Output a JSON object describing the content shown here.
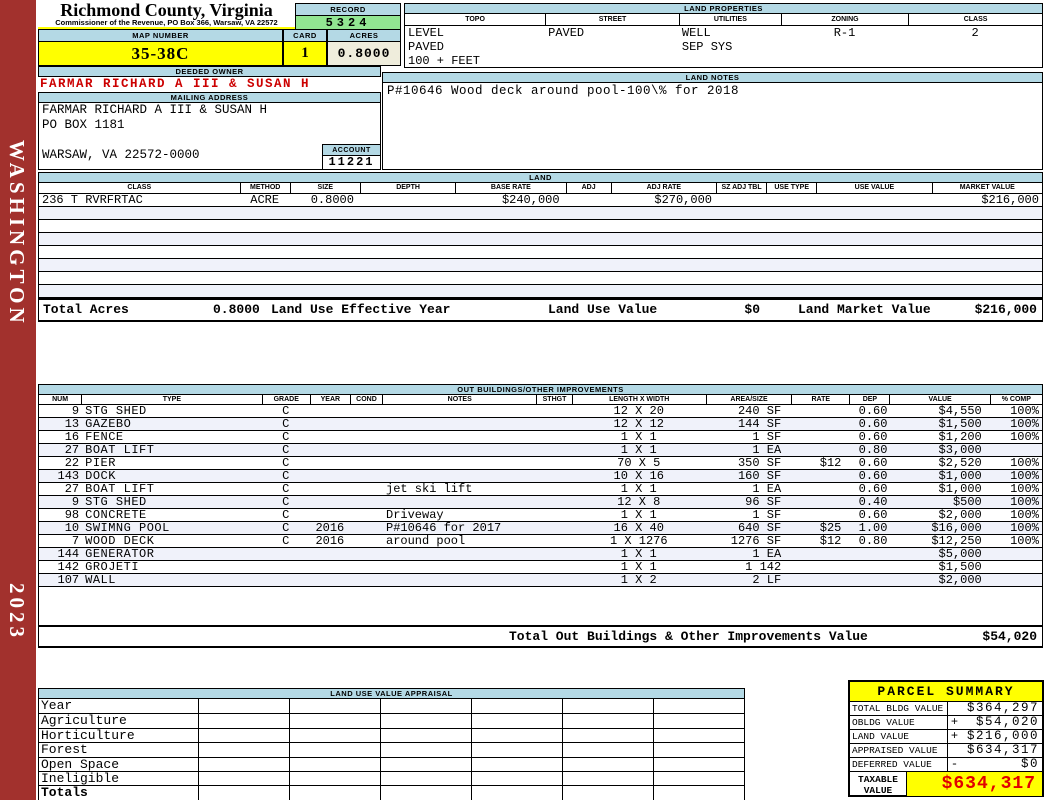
{
  "colors": {
    "sidebar": "#A2312D",
    "bar_blue": "#B4D9E5",
    "value_green": "#92E692",
    "value_yellow": "#FFFF00",
    "value_cream": "#EFEDDC",
    "stripe": "#F0F2FA",
    "owner_red": "#CC0000",
    "taxable_red": "#E10000"
  },
  "sidebar": {
    "county_name": "WASHINGTON",
    "year": "2023"
  },
  "header": {
    "title": "Richmond County, Virginia",
    "subtitle": "Commissioner of the Revenue, PO Box 366, Warsaw, VA 22572",
    "record_label": "RECORD",
    "record_value": "5324",
    "map_number_label": "MAP NUMBER",
    "map_number_value": "35-38C",
    "card_label": "CARD",
    "card_value": "1",
    "acres_label": "ACRES",
    "acres_value": "0.8000",
    "deeded_owner_label": "DEEDED OWNER",
    "deeded_owner": "FARMAR RICHARD A III & SUSAN H",
    "mailing_address_label": "MAILING ADDRESS",
    "mailing_lines": [
      "FARMAR RICHARD A III & SUSAN H",
      "PO BOX 1181",
      "",
      "WARSAW, VA 22572-0000"
    ],
    "account_label": "ACCOUNT",
    "account_value": "11221"
  },
  "land_properties": {
    "title": "LAND PROPERTIES",
    "columns": [
      "TOPO",
      "STREET",
      "UTILITIES",
      "ZONING",
      "CLASS"
    ],
    "rows": [
      {
        "topo": "LEVEL",
        "street": "PAVED",
        "utilities": "WELL",
        "zoning": "R-1",
        "class": "2"
      },
      {
        "topo": "PAVED",
        "street": "",
        "utilities": "SEP SYS",
        "zoning": "",
        "class": ""
      },
      {
        "topo": "100 + FEET",
        "street": "",
        "utilities": "",
        "zoning": "",
        "class": ""
      }
    ]
  },
  "land_notes": {
    "title": "LAND NOTES",
    "text": "P#10646 Wood deck around pool-100\\% for 2018"
  },
  "land": {
    "title": "LAND",
    "columns": [
      "CLASS",
      "METHOD",
      "SIZE",
      "DEPTH",
      "BASE RATE",
      "ADJ",
      "ADJ RATE",
      "SZ ADJ TBL",
      "USE TYPE",
      "USE VALUE",
      "MARKET VALUE"
    ],
    "rows": [
      {
        "class": "236 T RVRFRTAC",
        "method": "ACRE",
        "size": "0.8000",
        "depth": "",
        "base_rate": "$240,000",
        "adj": "",
        "adj_rate": "$270,000",
        "sz_adj_tbl": "",
        "use_type": "",
        "use_value": "",
        "market_value": "$216,000"
      }
    ],
    "totals": {
      "total_acres_label": "Total Acres",
      "total_acres": "0.8000",
      "effective_year_label": "Land Use Effective Year",
      "use_value_label": "Land Use Value",
      "use_value": "$0",
      "market_value_label": "Land Market Value",
      "market_value": "$216,000"
    }
  },
  "out_buildings": {
    "title": "OUT BUILDINGS/OTHER IMPROVEMENTS",
    "columns": [
      "NUM",
      "TYPE",
      "GRADE",
      "YEAR",
      "COND",
      "NOTES",
      "STHGT",
      "LENGTH X WIDTH",
      "AREA/SIZE",
      "RATE",
      "DEP",
      "VALUE",
      "% COMP"
    ],
    "rows": [
      {
        "num": "9",
        "type": "STG SHED",
        "grade": "C",
        "year": "",
        "cond": "",
        "notes": "",
        "sthgt": "",
        "lxw": "12 X 20",
        "area": "240 SF",
        "rate": "",
        "dep": "0.60",
        "value": "$4,550",
        "comp": "100%"
      },
      {
        "num": "13",
        "type": "GAZEBO",
        "grade": "C",
        "year": "",
        "cond": "",
        "notes": "",
        "sthgt": "",
        "lxw": "12 X 12",
        "area": "144 SF",
        "rate": "",
        "dep": "0.60",
        "value": "$1,500",
        "comp": "100%"
      },
      {
        "num": "16",
        "type": "FENCE",
        "grade": "C",
        "year": "",
        "cond": "",
        "notes": "",
        "sthgt": "",
        "lxw": "1 X 1",
        "area": "1 SF",
        "rate": "",
        "dep": "0.60",
        "value": "$1,200",
        "comp": "100%"
      },
      {
        "num": "27",
        "type": "BOAT LIFT",
        "grade": "C",
        "year": "",
        "cond": "",
        "notes": "",
        "sthgt": "",
        "lxw": "1 X 1",
        "area": "1 EA",
        "rate": "",
        "dep": "0.80",
        "value": "$3,000",
        "comp": ""
      },
      {
        "num": "22",
        "type": "PIER",
        "grade": "C",
        "year": "",
        "cond": "",
        "notes": "",
        "sthgt": "",
        "lxw": "70 X 5",
        "area": "350 SF",
        "rate": "$12",
        "dep": "0.60",
        "value": "$2,520",
        "comp": "100%"
      },
      {
        "num": "143",
        "type": "DOCK",
        "grade": "C",
        "year": "",
        "cond": "",
        "notes": "",
        "sthgt": "",
        "lxw": "10 X 16",
        "area": "160 SF",
        "rate": "",
        "dep": "0.60",
        "value": "$1,000",
        "comp": "100%"
      },
      {
        "num": "27",
        "type": "BOAT LIFT",
        "grade": "C",
        "year": "",
        "cond": "",
        "notes": "jet ski lift",
        "sthgt": "",
        "lxw": "1 X 1",
        "area": "1 EA",
        "rate": "",
        "dep": "0.60",
        "value": "$1,000",
        "comp": "100%"
      },
      {
        "num": "9",
        "type": "STG SHED",
        "grade": "C",
        "year": "",
        "cond": "",
        "notes": "",
        "sthgt": "",
        "lxw": "12 X 8",
        "area": "96 SF",
        "rate": "",
        "dep": "0.40",
        "value": "$500",
        "comp": "100%"
      },
      {
        "num": "98",
        "type": "CONCRETE",
        "grade": "C",
        "year": "",
        "cond": "",
        "notes": "Driveway",
        "sthgt": "",
        "lxw": "1 X 1",
        "area": "1 SF",
        "rate": "",
        "dep": "0.60",
        "value": "$2,000",
        "comp": "100%"
      },
      {
        "num": "10",
        "type": "SWIMNG POOL",
        "grade": "C",
        "year": "2016",
        "cond": "",
        "notes": "P#10646 for 2017",
        "sthgt": "",
        "lxw": "16 X 40",
        "area": "640 SF",
        "rate": "$25",
        "dep": "1.00",
        "value": "$16,000",
        "comp": "100%"
      },
      {
        "num": "7",
        "type": "WOOD DECK",
        "grade": "C",
        "year": "2016",
        "cond": "",
        "notes": "around pool",
        "sthgt": "",
        "lxw": "1 X 1276",
        "area": "1276 SF",
        "rate": "$12",
        "dep": "0.80",
        "value": "$12,250",
        "comp": "100%"
      },
      {
        "num": "144",
        "type": "GENERATOR",
        "grade": "",
        "year": "",
        "cond": "",
        "notes": "",
        "sthgt": "",
        "lxw": "1 X 1",
        "area": "1 EA",
        "rate": "",
        "dep": "",
        "value": "$5,000",
        "comp": ""
      },
      {
        "num": "142",
        "type": "GROJETI",
        "grade": "",
        "year": "",
        "cond": "",
        "notes": "",
        "sthgt": "",
        "lxw": "1 X 1",
        "area": "1 142",
        "rate": "",
        "dep": "",
        "value": "$1,500",
        "comp": ""
      },
      {
        "num": "107",
        "type": "WALL",
        "grade": "",
        "year": "",
        "cond": "",
        "notes": "",
        "sthgt": "",
        "lxw": "1 X 2",
        "area": "2 LF",
        "rate": "",
        "dep": "",
        "value": "$2,000",
        "comp": ""
      }
    ],
    "total_label": "Total Out Buildings & Other Improvements Value",
    "total_value": "$54,020"
  },
  "land_use_appraisal": {
    "title": "LAND USE VALUE APPRAISAL",
    "row_labels": [
      "Year",
      "Agriculture",
      "Horticulture",
      "Forest",
      "Open Space",
      "Ineligible",
      "Totals"
    ]
  },
  "parcel_summary": {
    "title": "PARCEL SUMMARY",
    "rows": [
      {
        "label": "TOTAL BLDG VALUE",
        "op": "",
        "value": "$364,297"
      },
      {
        "label": "OBLDG VALUE",
        "op": "+",
        "value": "$54,020"
      },
      {
        "label": "LAND VALUE",
        "op": "+",
        "value": "$216,000"
      },
      {
        "label": "APPRAISED VALUE",
        "op": "",
        "value": "$634,317"
      },
      {
        "label": "DEFERRED VALUE",
        "op": "-",
        "value": "$0"
      }
    ],
    "taxable_label": "TAXABLE VALUE",
    "taxable_value": "$634,317"
  }
}
